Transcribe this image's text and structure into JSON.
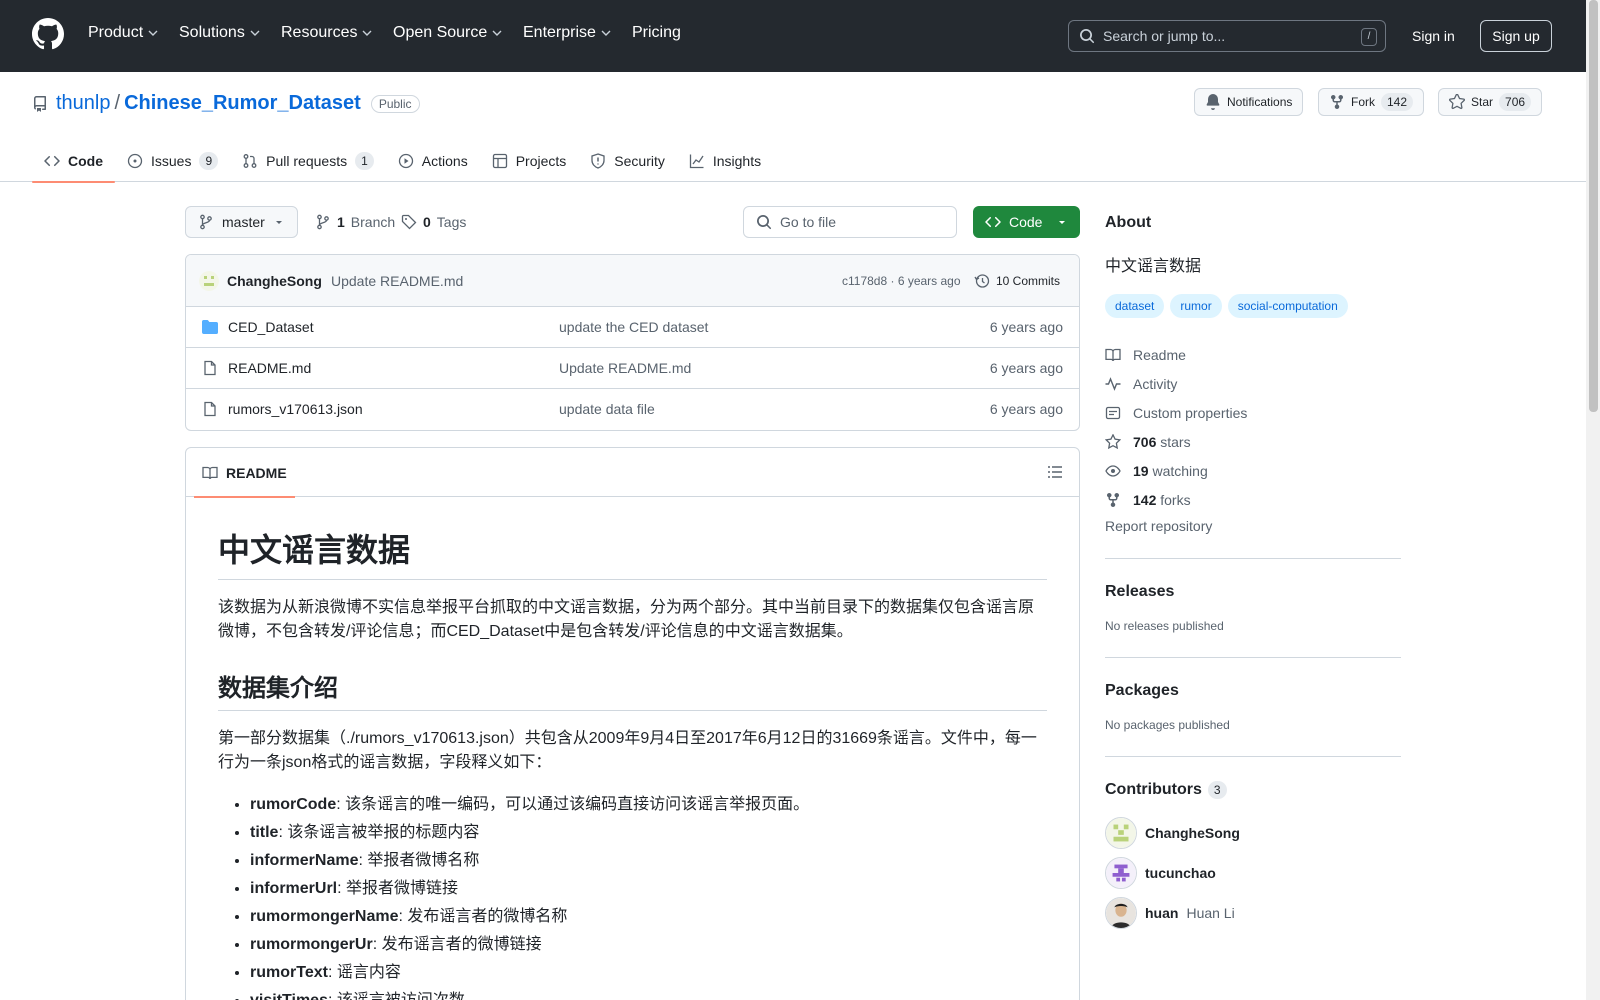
{
  "nav": {
    "items": [
      "Product",
      "Solutions",
      "Resources",
      "Open Source",
      "Enterprise"
    ],
    "pricing": "Pricing",
    "search_placeholder": "Search or jump to...",
    "search_key": "/",
    "signin": "Sign in",
    "signup": "Sign up"
  },
  "repo": {
    "owner": "thunlp",
    "sep": "/",
    "name": "Chinese_Rumor_Dataset",
    "visibility": "Public",
    "notifications": "Notifications",
    "fork_label": "Fork",
    "fork_count": "142",
    "star_label": "Star",
    "star_count": "706"
  },
  "tabs": [
    {
      "label": "Code",
      "icon": "code-icon"
    },
    {
      "label": "Issues",
      "count": "9",
      "icon": "issue-icon"
    },
    {
      "label": "Pull requests",
      "count": "1",
      "icon": "pr-icon"
    },
    {
      "label": "Actions",
      "icon": "play-icon"
    },
    {
      "label": "Projects",
      "icon": "table-icon"
    },
    {
      "label": "Security",
      "icon": "shield-icon"
    },
    {
      "label": "Insights",
      "icon": "graph-icon"
    }
  ],
  "branch": {
    "name": "master",
    "branch_count": "1",
    "branch_label": "Branch",
    "tag_count": "0",
    "tag_label": "Tags",
    "gofile": "Go to file",
    "code_label": "Code"
  },
  "commit": {
    "author": "ChangheSong",
    "message": "Update README.md",
    "hash_age": "c1178d8 · 6 years ago",
    "commits": "10 Commits"
  },
  "files": [
    {
      "name": "CED_Dataset",
      "type": "folder",
      "msg": "update the CED dataset",
      "age": "6 years ago"
    },
    {
      "name": "README.md",
      "type": "file",
      "msg": "Update README.md",
      "age": "6 years ago"
    },
    {
      "name": "rumors_v170613.json",
      "type": "file",
      "msg": "update data file",
      "age": "6 years ago"
    }
  ],
  "readme": {
    "tab": "README",
    "h1": "中文谣言数据",
    "p1": "该数据为从新浪微博不实信息举报平台抓取的中文谣言数据，分为两个部分。其中当前目录下的数据集仅包含谣言原微博，不包含转发/评论信息；而CED_Dataset中是包含转发/评论信息的中文谣言数据集。",
    "h2": "数据集介绍",
    "p2": "第一部分数据集（./rumors_v170613.json）共包含从2009年9月4日至2017年6月12日的31669条谣言。文件中，每一行为一条json格式的谣言数据，字段释义如下：",
    "fields": [
      {
        "key": "rumorCode",
        "desc": ": 该条谣言的唯一编码，可以通过该编码直接访问该谣言举报页面。"
      },
      {
        "key": "title",
        "desc": ": 该条谣言被举报的标题内容"
      },
      {
        "key": "informerName",
        "desc": ": 举报者微博名称"
      },
      {
        "key": "informerUrl",
        "desc": ": 举报者微博链接"
      },
      {
        "key": "rumormongerName",
        "desc": ": 发布谣言者的微博名称"
      },
      {
        "key": "rumormongerUr",
        "desc": ": 发布谣言者的微博链接"
      },
      {
        "key": "rumorText",
        "desc": ": 谣言内容"
      },
      {
        "key": "visitTimes",
        "desc": ": 该谣言被访问次数"
      }
    ]
  },
  "about": {
    "title": "About",
    "desc": "中文谣言数据",
    "topics": [
      "dataset",
      "rumor",
      "social-computation"
    ],
    "readme": "Readme",
    "activity": "Activity",
    "custom": "Custom properties",
    "stars_n": "706",
    "stars": "stars",
    "watching_n": "19",
    "watching": "watching",
    "forks_n": "142",
    "forks": "forks",
    "report": "Report repository"
  },
  "releases": {
    "title": "Releases",
    "sub": "No releases published"
  },
  "packages": {
    "title": "Packages",
    "sub": "No packages published"
  },
  "contributors": {
    "title": "Contributors",
    "count": "3",
    "list": [
      {
        "login": "ChangheSong",
        "name": ""
      },
      {
        "login": "tucunchao",
        "name": ""
      },
      {
        "login": "huan",
        "name": "Huan Li"
      }
    ]
  }
}
